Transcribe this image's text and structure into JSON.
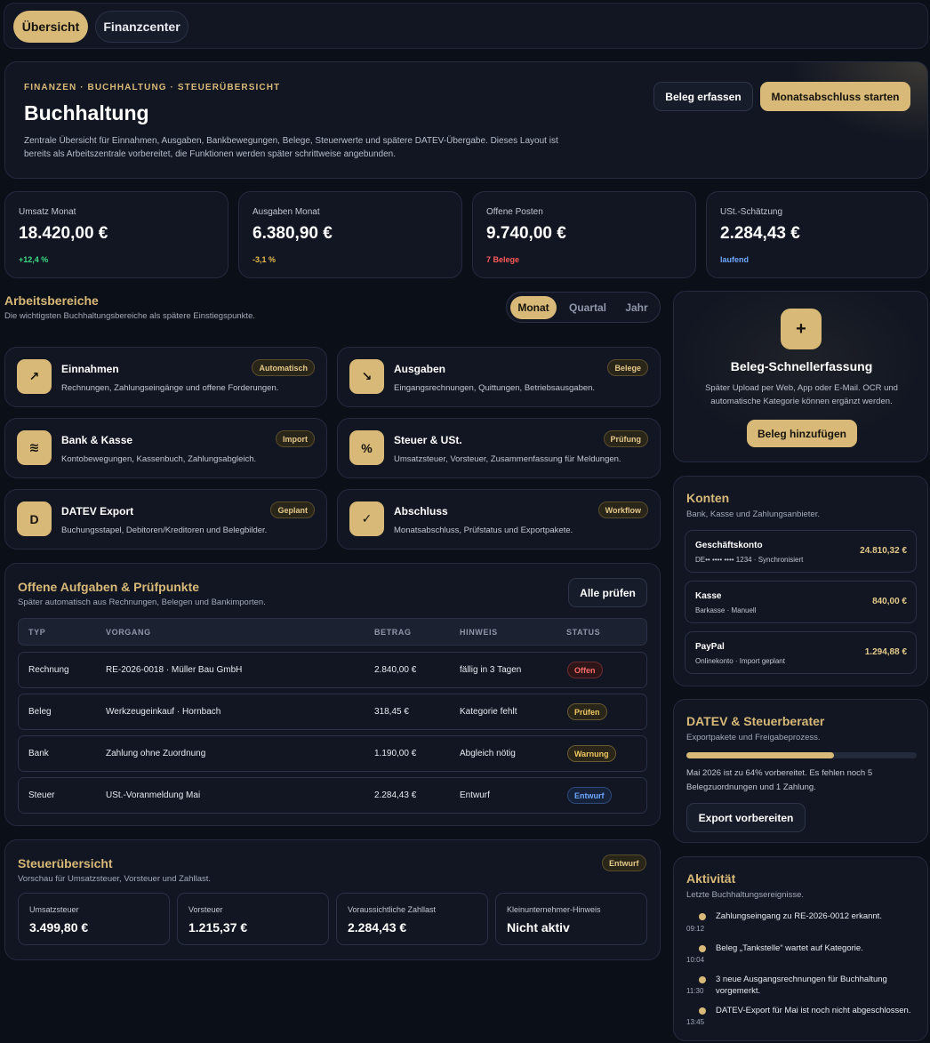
{
  "tabs": [
    "Übersicht",
    "Finanzcenter"
  ],
  "hero": {
    "kicker": "FINANZEN · BUCHHALTUNG · STEUERÜBERSICHT",
    "title": "Buchhaltung",
    "description": "Zentrale Übersicht für Einnahmen, Ausgaben, Bankbewegungen, Belege, Steuerwerte und spätere DATEV-Übergabe. Dieses Layout ist bereits als Arbeitszentrale vorbereitet, die Funktionen werden später schrittweise angebunden.",
    "btn_capture": "Beleg erfassen",
    "btn_close": "Monatsabschluss starten"
  },
  "kpis": [
    {
      "label": "Umsatz Monat",
      "value": "18.420,00 €",
      "sub": "+12,4 %",
      "sub_color": "#3ddc84"
    },
    {
      "label": "Ausgaben Monat",
      "value": "6.380,90 €",
      "sub": "-3,1 %",
      "sub_color": "#e6b84a"
    },
    {
      "label": "Offene Posten",
      "value": "9.740,00 €",
      "sub": "7 Belege",
      "sub_color": "#ff5a5a"
    },
    {
      "label": "USt.-Schätzung",
      "value": "2.284,43 €",
      "sub": "laufend",
      "sub_color": "#6ea8ff"
    }
  ],
  "areas_section": {
    "title": "Arbeitsbereiche",
    "subtitle": "Die wichtigsten Buchhaltungsbereiche als spätere Einstiegspunkte.",
    "periods": [
      "Monat",
      "Quartal",
      "Jahr"
    ]
  },
  "areas": [
    {
      "icon": "↗",
      "icon_name": "trend-up-icon",
      "title": "Einnahmen",
      "badge": "Automatisch",
      "desc": "Rechnungen, Zahlungseingänge und offene Forderungen."
    },
    {
      "icon": "↘",
      "icon_name": "trend-down-icon",
      "title": "Ausgaben",
      "badge": "Belege",
      "desc": "Eingangsrechnungen, Quittungen, Betriebsausgaben."
    },
    {
      "icon": "≋",
      "icon_name": "waves-icon",
      "title": "Bank & Kasse",
      "badge": "Import",
      "desc": "Kontobewegungen, Kassenbuch, Zahlungsabgleich."
    },
    {
      "icon": "%",
      "icon_name": "percent-icon",
      "title": "Steuer & USt.",
      "badge": "Prüfung",
      "desc": "Umsatzsteuer, Vorsteuer, Zusammenfassung für Meldungen."
    },
    {
      "icon": "D",
      "icon_name": "datev-icon",
      "title": "DATEV Export",
      "badge": "Geplant",
      "desc": "Buchungsstapel, Debitoren/Kreditoren und Belegbilder."
    },
    {
      "icon": "✓",
      "icon_name": "check-icon",
      "title": "Abschluss",
      "badge": "Workflow",
      "desc": "Monatsabschluss, Prüfstatus und Exportpakete."
    }
  ],
  "tasks": {
    "title": "Offene Aufgaben & Prüfpunkte",
    "subtitle": "Später automatisch aus Rechnungen, Belegen und Bankimporten.",
    "button": "Alle prüfen",
    "headers": [
      "TYP",
      "VORGANG",
      "BETRAG",
      "HINWEIS",
      "STATUS"
    ],
    "rows": [
      {
        "type": "Rechnung",
        "process": "RE-2026-0018 · Müller Bau GmbH",
        "amount": "2.840,00 €",
        "note": "fällig in 3 Tagen",
        "status": "Offen",
        "tone": "red"
      },
      {
        "type": "Beleg",
        "process": "Werkzeugeinkauf · Hornbach",
        "amount": "318,45 €",
        "note": "Kategorie fehlt",
        "status": "Prüfen",
        "tone": "gold"
      },
      {
        "type": "Bank",
        "process": "Zahlung ohne Zuordnung",
        "amount": "1.190,00 €",
        "note": "Abgleich nötig",
        "status": "Warnung",
        "tone": "gold"
      },
      {
        "type": "Steuer",
        "process": "USt.-Voranmeldung Mai",
        "amount": "2.284,43 €",
        "note": "Entwurf",
        "status": "Entwurf",
        "tone": "blue"
      }
    ]
  },
  "tax": {
    "title": "Steuerübersicht",
    "subtitle": "Vorschau für Umsatzsteuer, Vorsteuer und Zahllast.",
    "badge": "Entwurf",
    "boxes": [
      {
        "label": "Umsatzsteuer",
        "value": "3.499,80 €"
      },
      {
        "label": "Vorsteuer",
        "value": "1.215,37 €"
      },
      {
        "label": "Voraussichtliche Zahllast",
        "value": "2.284,43 €"
      },
      {
        "label": "Kleinunternehmer-Hinweis",
        "value": "Nicht aktiv"
      }
    ]
  },
  "quick": {
    "icon": "+",
    "title": "Beleg-Schnellerfassung",
    "desc": "Später Upload per Web, App oder E-Mail. OCR und automatische Kategorie können ergänzt werden.",
    "button": "Beleg hinzufügen"
  },
  "accounts": {
    "title": "Konten",
    "subtitle": "Bank, Kasse und Zahlungsanbieter.",
    "items": [
      {
        "name": "Geschäftskonto",
        "meta": "DE•• •••• •••• 1234 · Synchronisiert",
        "amount": "24.810,32 €"
      },
      {
        "name": "Kasse",
        "meta": "Barkasse · Manuell",
        "amount": "840,00 €"
      },
      {
        "name": "PayPal",
        "meta": "Onlinekonto · Import geplant",
        "amount": "1.294,88 €"
      }
    ]
  },
  "datev": {
    "title": "DATEV & Steuerberater",
    "subtitle": "Exportpakete und Freigabeprozess.",
    "progress": 0.64,
    "text": "Mai 2026 ist zu 64% vorbereitet. Es fehlen noch 5 Belegzuordnungen und 1 Zahlung.",
    "button": "Export vorbereiten"
  },
  "activity": {
    "title": "Aktivität",
    "subtitle": "Letzte Buchhaltungsereignisse.",
    "items": [
      {
        "text": "Zahlungseingang zu RE-2026-0012 erkannt.",
        "time": "09:12"
      },
      {
        "text": "Beleg „Tankstelle“ wartet auf Kategorie.",
        "time": "10:04"
      },
      {
        "text": "3 neue Ausgangsrechnungen für Buchhaltung vorgemerkt.",
        "time": "11:30"
      },
      {
        "text": "DATEV-Export für Mai ist noch nicht abgeschlossen.",
        "time": "13:45"
      }
    ]
  }
}
